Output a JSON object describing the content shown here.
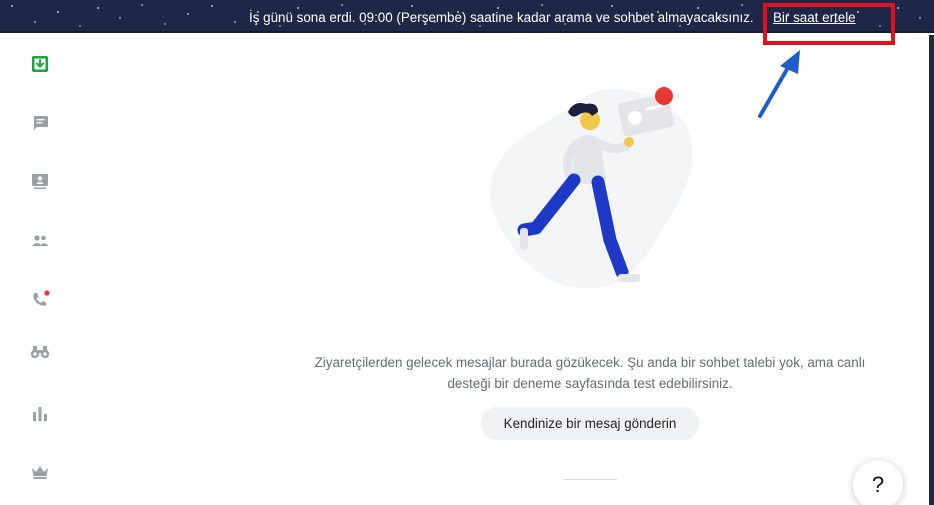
{
  "banner": {
    "message": "İş günü sona erdi. 09:00 (Perşembe) saatine kadar arama ve sohbet almayacaksınız.",
    "snooze_label": "Bir saat ertele"
  },
  "sidebar": {
    "items": [
      {
        "id": "inbox",
        "icon": "inbox-download-icon",
        "active": true
      },
      {
        "id": "chats",
        "icon": "chat-bubble-icon"
      },
      {
        "id": "visitors-board",
        "icon": "contact-board-icon"
      },
      {
        "id": "contacts",
        "icon": "people-icon"
      },
      {
        "id": "calls",
        "icon": "phone-icon",
        "badge": true
      },
      {
        "id": "monitoring",
        "icon": "binoculars-icon"
      },
      {
        "id": "reports",
        "icon": "bar-chart-icon"
      },
      {
        "id": "upgrade",
        "icon": "crown-icon"
      }
    ]
  },
  "main": {
    "empty_message": "Ziyaretçilerden gelecek mesajlar burada gözükecek. Şu anda bir sohbet talebi yok, ama canlı desteği bir deneme sayfasında test edebilirsiniz.",
    "send_test_label": "Kendinize bir mesaj gönderin"
  },
  "help": {
    "label": "?"
  },
  "colors": {
    "banner_bg": "#1f2749",
    "active_icon": "#17a83a",
    "icon_gray": "#9ba0a6",
    "badge_red": "#e53935",
    "annotation_red": "#e2101b",
    "annotation_arrow": "#1f5ec9"
  }
}
